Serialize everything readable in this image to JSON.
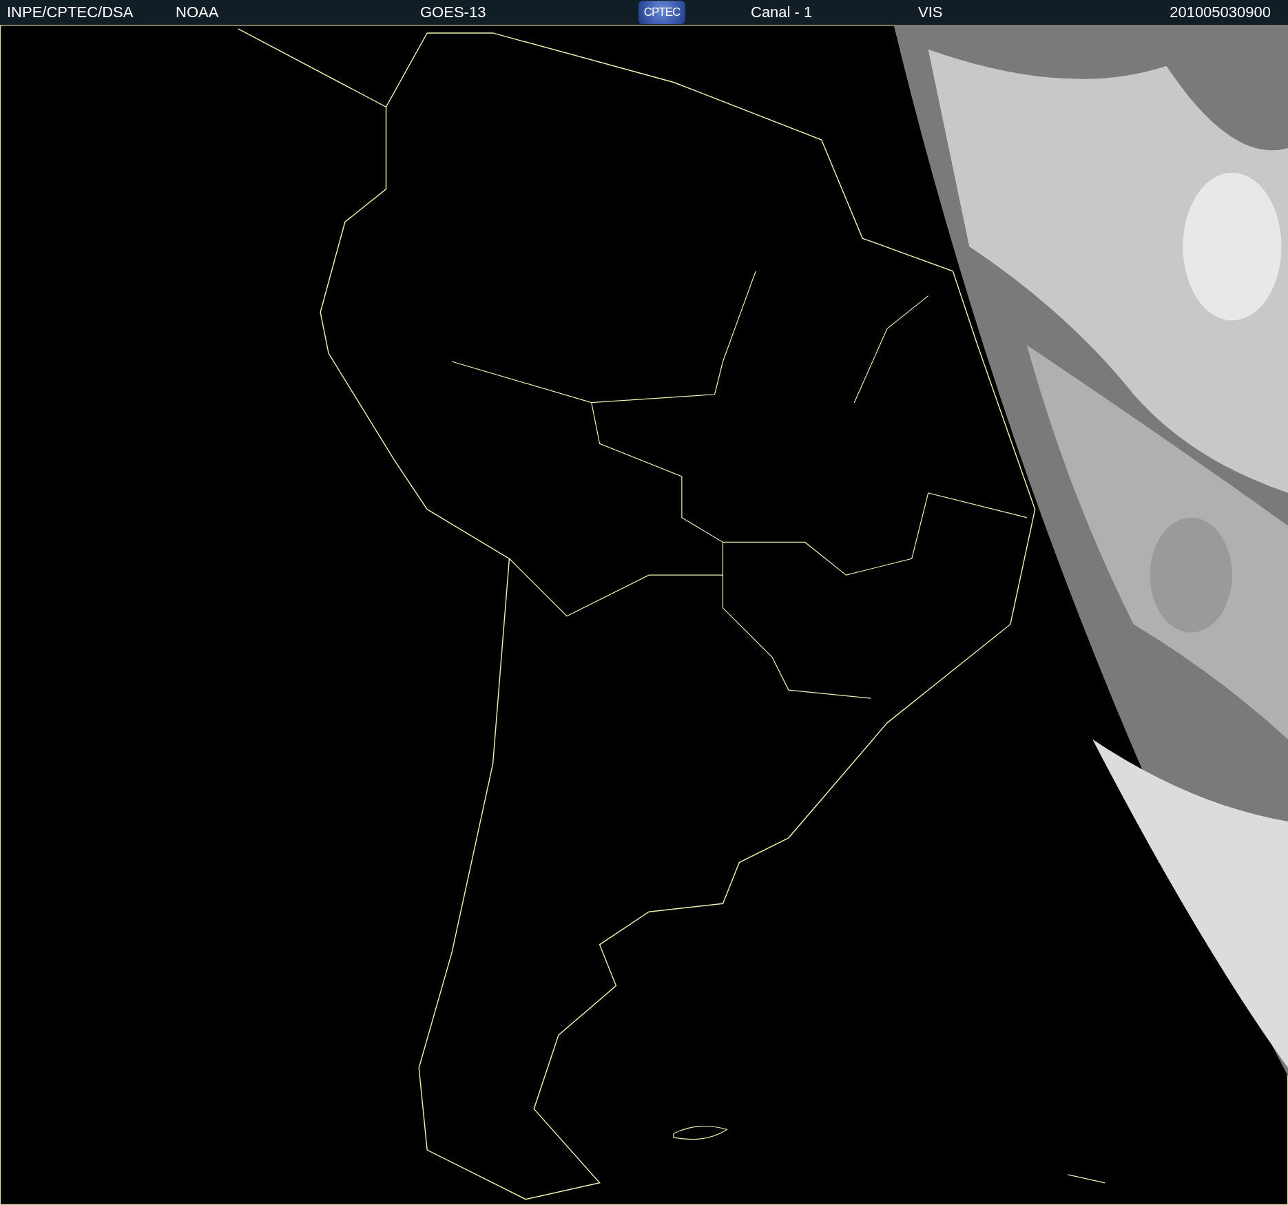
{
  "header": {
    "institution": "INPE/CPTEC/DSA",
    "agency": "NOAA",
    "satellite": "GOES-13",
    "logo": "CPTEC",
    "channel": "Canal - 1",
    "band": "VIS",
    "timestamp": "201005030900"
  }
}
